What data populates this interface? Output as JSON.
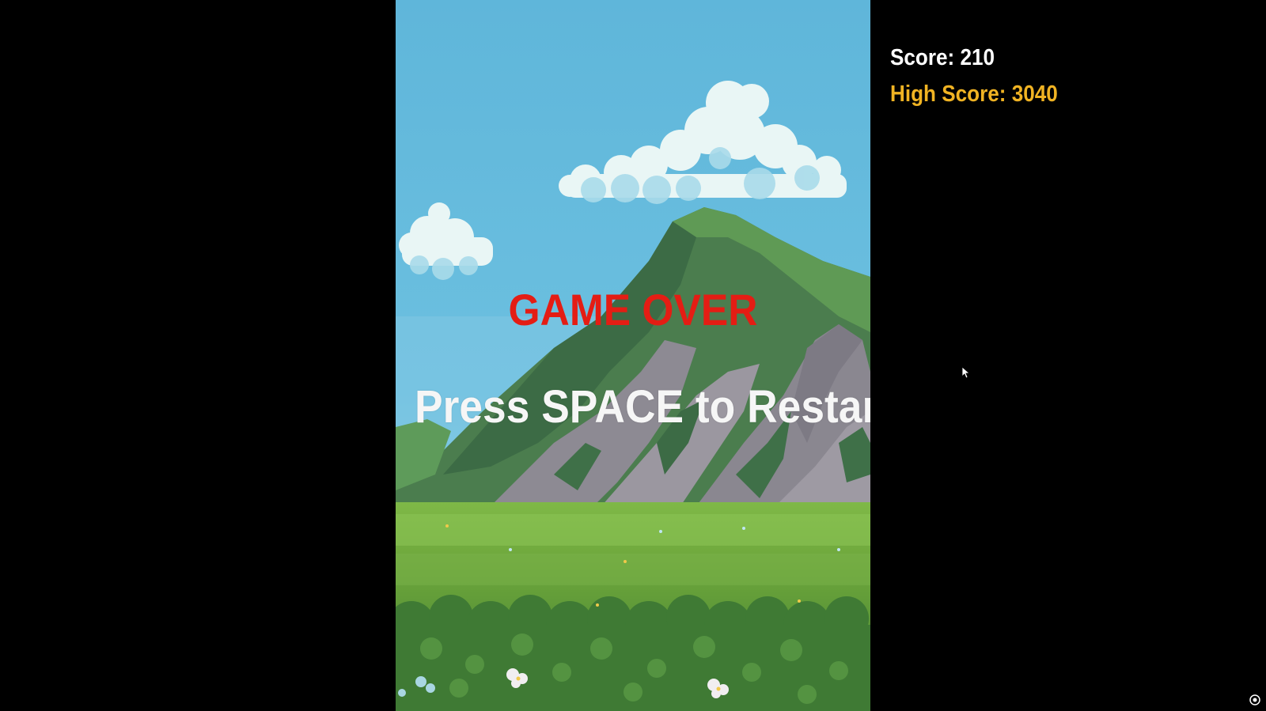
{
  "game": {
    "title_text": "GAME OVER",
    "restart_prompt": "Press SPACE to Restart"
  },
  "hud": {
    "score_label": "Score: 210",
    "high_score_label": "High Score: 3040",
    "score_value": 210,
    "high_score_value": 3040
  },
  "colors": {
    "background": "#000000",
    "sky": "#63b9dc",
    "game_over": "#e41d14",
    "restart_prompt": "#f6f6f6",
    "score": "#ffffff",
    "high_score": "#f0b323",
    "mountain_dark": "#3f7048",
    "mountain_rock": "#8e8a93",
    "grass": "#6da63d"
  },
  "icons": {
    "cursor": "mouse-pointer-icon",
    "corner": "screen-capture-icon"
  }
}
